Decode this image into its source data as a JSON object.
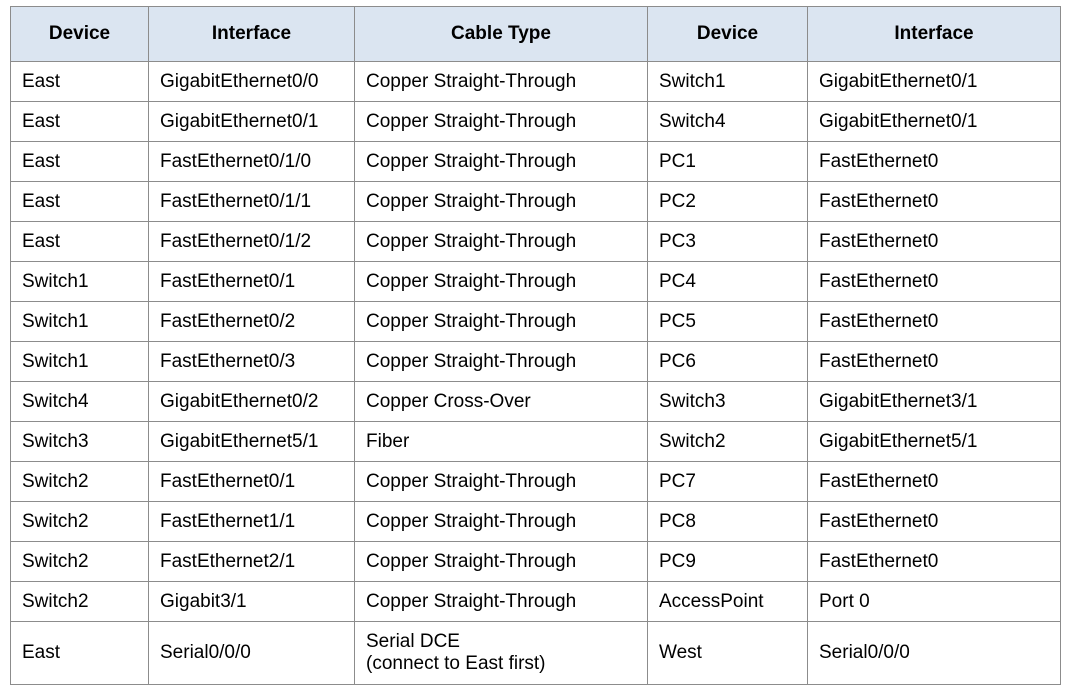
{
  "headers": [
    "Device",
    "Interface",
    "Cable Type",
    "Device",
    "Interface"
  ],
  "rows": [
    [
      "East",
      "GigabitEthernet0/0",
      "Copper Straight-Through",
      "Switch1",
      "GigabitEthernet0/1"
    ],
    [
      "East",
      "GigabitEthernet0/1",
      "Copper Straight-Through",
      "Switch4",
      "GigabitEthernet0/1"
    ],
    [
      "East",
      "FastEthernet0/1/0",
      "Copper Straight-Through",
      "PC1",
      "FastEthernet0"
    ],
    [
      "East",
      "FastEthernet0/1/1",
      "Copper Straight-Through",
      "PC2",
      "FastEthernet0"
    ],
    [
      "East",
      "FastEthernet0/1/2",
      "Copper Straight-Through",
      "PC3",
      "FastEthernet0"
    ],
    [
      "Switch1",
      "FastEthernet0/1",
      "Copper Straight-Through",
      "PC4",
      "FastEthernet0"
    ],
    [
      "Switch1",
      "FastEthernet0/2",
      "Copper Straight-Through",
      "PC5",
      "FastEthernet0"
    ],
    [
      "Switch1",
      "FastEthernet0/3",
      "Copper Straight-Through",
      "PC6",
      "FastEthernet0"
    ],
    [
      "Switch4",
      "GigabitEthernet0/2",
      "Copper Cross-Over",
      "Switch3",
      "GigabitEthernet3/1"
    ],
    [
      "Switch3",
      "GigabitEthernet5/1",
      "Fiber",
      "Switch2",
      "GigabitEthernet5/1"
    ],
    [
      "Switch2",
      "FastEthernet0/1",
      "Copper Straight-Through",
      "PC7",
      "FastEthernet0"
    ],
    [
      "Switch2",
      "FastEthernet1/1",
      "Copper Straight-Through",
      "PC8",
      "FastEthernet0"
    ],
    [
      "Switch2",
      "FastEthernet2/1",
      "Copper Straight-Through",
      "PC9",
      "FastEthernet0"
    ],
    [
      "Switch2",
      "Gigabit3/1",
      "Copper Straight-Through",
      "AccessPoint",
      "Port 0"
    ]
  ],
  "last_row": {
    "device_a": "East",
    "interface_a": "Serial0/0/0",
    "cable_line1": "Serial DCE",
    "cable_line2": "(connect to East first)",
    "device_b": "West",
    "interface_b": "Serial0/0/0"
  },
  "colors": {
    "header_bg": "#dbe5f1",
    "border": "#8c8c8c"
  }
}
